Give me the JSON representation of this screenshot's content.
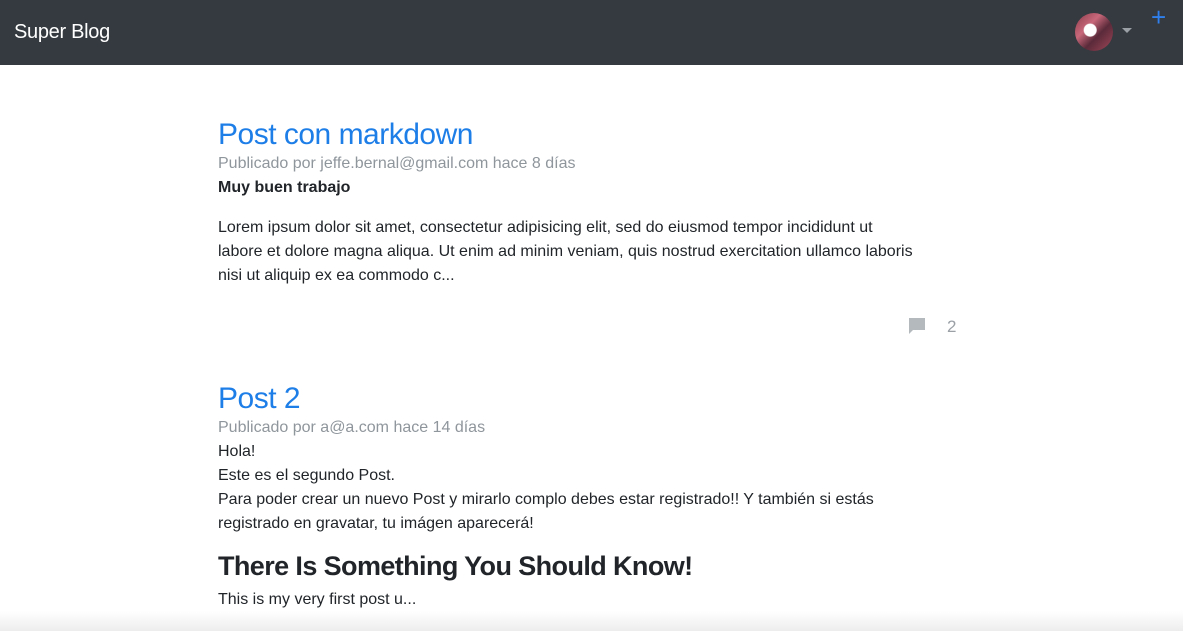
{
  "navbar": {
    "brand": "Super Blog",
    "add_label": "+"
  },
  "posts": [
    {
      "title": "Post con markdown",
      "meta": "Publicado por jeffe.bernal@gmail.com hace 8 días",
      "bold_line": "Muy buen trabajo",
      "body": [
        "Lorem ipsum dolor sit amet, consectetur adipisicing elit, sed do eiusmod tempor incididunt ut",
        "labore et dolore magna aliqua. Ut enim ad minim veniam, quis nostrud exercitation ullamco laboris",
        "nisi ut aliquip ex ea commodo c..."
      ],
      "comment_count": "2"
    },
    {
      "title": "Post 2",
      "meta": "Publicado por a@a.com hace 14 días",
      "body": [
        "Hola!",
        "Este es el segundo Post.",
        "Para poder crear un nuevo Post y mirarlo complo debes estar registrado!! Y también si estás",
        "registrado en gravatar, tu imágen aparecerá!"
      ],
      "heading": "There Is Something You Should Know!",
      "excerpt": "This is my very first post u..."
    }
  ],
  "colors": {
    "navbar_bg": "#343a40",
    "link": "#1e7ee8",
    "muted": "#8f969c",
    "accent": "#2f80ed"
  },
  "icons": {
    "avatar": "user-avatar",
    "dropdown": "caret-down-icon",
    "add": "plus-icon",
    "comments": "comment-icon"
  }
}
